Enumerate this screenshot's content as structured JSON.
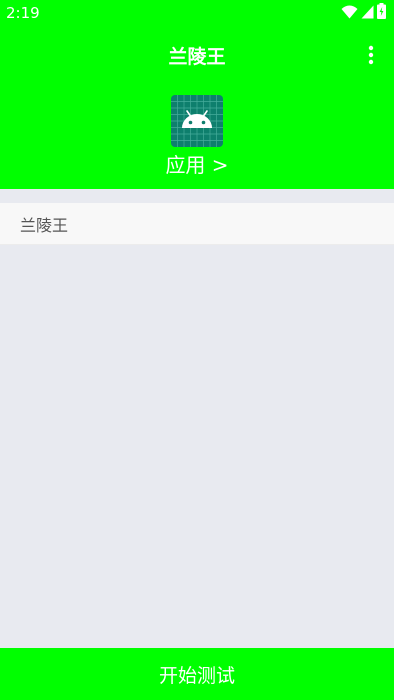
{
  "status_bar": {
    "time": "2:19",
    "icons": [
      "wifi-icon",
      "signal-icon",
      "battery-icon"
    ]
  },
  "toolbar": {
    "title": "兰陵王",
    "menu_icon": "more-vert-icon"
  },
  "app_header": {
    "icon": "android-app-icon",
    "link_label": "应用 >"
  },
  "list": {
    "items": [
      {
        "label": "兰陵王"
      }
    ]
  },
  "footer": {
    "start_label": "开始测试"
  },
  "colors": {
    "accent": "#00ff00",
    "background": "#e8eaf0",
    "list_item_bg": "#f8f8f8",
    "icon_bg": "#0e7f6d",
    "text_on_accent": "#ffffff"
  }
}
